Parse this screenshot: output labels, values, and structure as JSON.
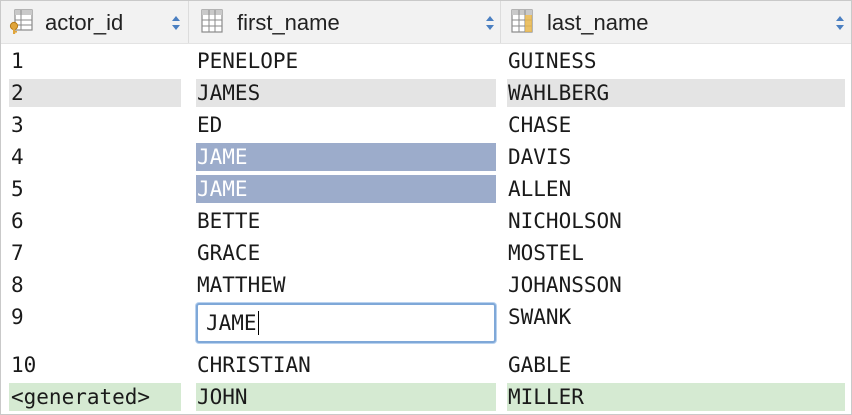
{
  "columns": [
    {
      "name": "actor_id",
      "icon": "key-column-icon",
      "sort_icon": "sort-updown-icon"
    },
    {
      "name": "first_name",
      "icon": "table-column-icon",
      "sort_icon": "sort-updown-icon"
    },
    {
      "name": "last_name",
      "icon": "indexed-column-icon",
      "sort_icon": "sort-updown-icon"
    }
  ],
  "rows": [
    {
      "actor_id": "1",
      "first_name": "PENELOPE",
      "last_name": "GUINESS"
    },
    {
      "actor_id": "2",
      "first_name": "JAMES",
      "last_name": "WAHLBERG"
    },
    {
      "actor_id": "3",
      "first_name": "ED",
      "last_name": "CHASE"
    },
    {
      "actor_id": "4",
      "first_name": "JAME",
      "last_name": "DAVIS"
    },
    {
      "actor_id": "5",
      "first_name": "JAME",
      "last_name": "ALLEN"
    },
    {
      "actor_id": "6",
      "first_name": "BETTE",
      "last_name": "NICHOLSON"
    },
    {
      "actor_id": "7",
      "first_name": "GRACE",
      "last_name": "MOSTEL"
    },
    {
      "actor_id": "8",
      "first_name": "MATTHEW",
      "last_name": "JOHANSSON"
    },
    {
      "actor_id": "9",
      "first_name": "JAME",
      "last_name": "SWANK"
    },
    {
      "actor_id": "10",
      "first_name": "CHRISTIAN",
      "last_name": "GABLE"
    },
    {
      "actor_id": "<generated>",
      "first_name": "JOHN",
      "last_name": "MILLER"
    }
  ],
  "colors": {
    "selection": "#9caccb",
    "stripe": "#e4e4e4",
    "new_row": "#d5ead2",
    "edit_border": "#7fa8d8"
  }
}
